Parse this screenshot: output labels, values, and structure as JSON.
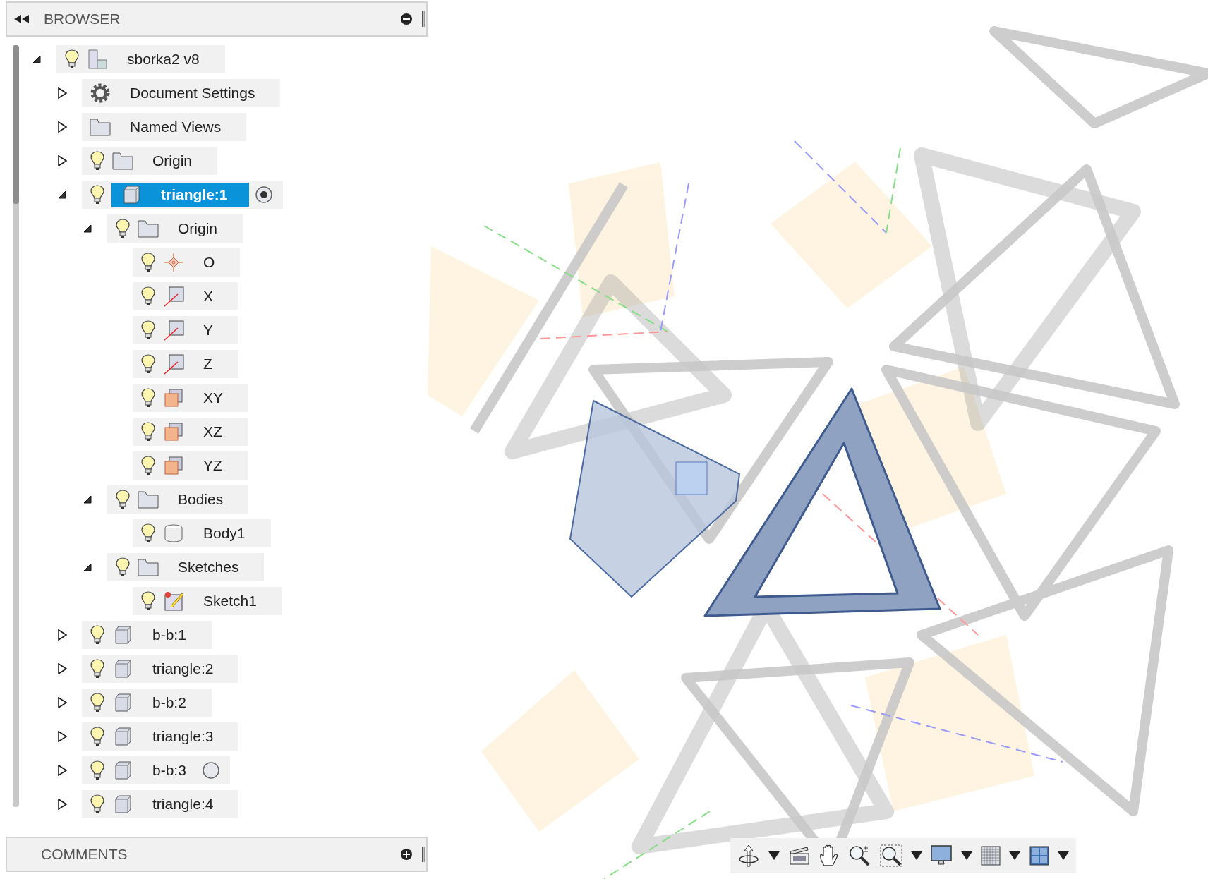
{
  "browser": {
    "title": "BROWSER",
    "tree": [
      {
        "label": "sborka2 v8",
        "kind": "assembly",
        "light_bulb": true,
        "expanded": true,
        "selected": false,
        "children": [
          {
            "label": "Document Settings",
            "kind": "gear",
            "light_bulb": false,
            "expanded": false,
            "selected": false
          },
          {
            "label": "Named Views",
            "kind": "folder",
            "light_bulb": false,
            "expanded": false,
            "selected": false
          },
          {
            "label": "Origin",
            "kind": "folder",
            "light_bulb": true,
            "expanded": false,
            "selected": false
          },
          {
            "label": "triangle:1",
            "kind": "component",
            "light_bulb": true,
            "expanded": true,
            "selected": true,
            "active": true,
            "children": [
              {
                "label": "Origin",
                "kind": "folder",
                "light_bulb": true,
                "expanded": true,
                "selected": false,
                "children": [
                  {
                    "label": "O",
                    "kind": "point",
                    "light_bulb": true,
                    "selected": false
                  },
                  {
                    "label": "X",
                    "kind": "axis",
                    "light_bulb": true,
                    "selected": false
                  },
                  {
                    "label": "Y",
                    "kind": "axis",
                    "light_bulb": true,
                    "selected": false
                  },
                  {
                    "label": "Z",
                    "kind": "axis",
                    "light_bulb": true,
                    "selected": false
                  },
                  {
                    "label": "XY",
                    "kind": "plane",
                    "light_bulb": true,
                    "selected": false
                  },
                  {
                    "label": "XZ",
                    "kind": "plane",
                    "light_bulb": true,
                    "selected": false
                  },
                  {
                    "label": "YZ",
                    "kind": "plane",
                    "light_bulb": true,
                    "selected": false
                  }
                ]
              },
              {
                "label": "Bodies",
                "kind": "folder",
                "light_bulb": true,
                "expanded": true,
                "selected": false,
                "children": [
                  {
                    "label": "Body1",
                    "kind": "body",
                    "light_bulb": true,
                    "selected": false
                  }
                ]
              },
              {
                "label": "Sketches",
                "kind": "folder",
                "light_bulb": true,
                "expanded": true,
                "selected": false,
                "children": [
                  {
                    "label": "Sketch1",
                    "kind": "sketch",
                    "light_bulb": true,
                    "selected": false
                  }
                ]
              }
            ]
          },
          {
            "label": "b-b:1",
            "kind": "component",
            "light_bulb": true,
            "expanded": false,
            "selected": false
          },
          {
            "label": "triangle:2",
            "kind": "component",
            "light_bulb": true,
            "expanded": false,
            "selected": false
          },
          {
            "label": "b-b:2",
            "kind": "component",
            "light_bulb": true,
            "expanded": false,
            "selected": false
          },
          {
            "label": "triangle:3",
            "kind": "component",
            "light_bulb": true,
            "expanded": false,
            "selected": false
          },
          {
            "label": "b-b:3",
            "kind": "component",
            "light_bulb": true,
            "expanded": false,
            "selected": false,
            "active": false
          },
          {
            "label": "triangle:4",
            "kind": "component",
            "light_bulb": true,
            "expanded": false,
            "selected": false
          }
        ]
      }
    ]
  },
  "comments": {
    "title": "COMMENTS"
  }
}
